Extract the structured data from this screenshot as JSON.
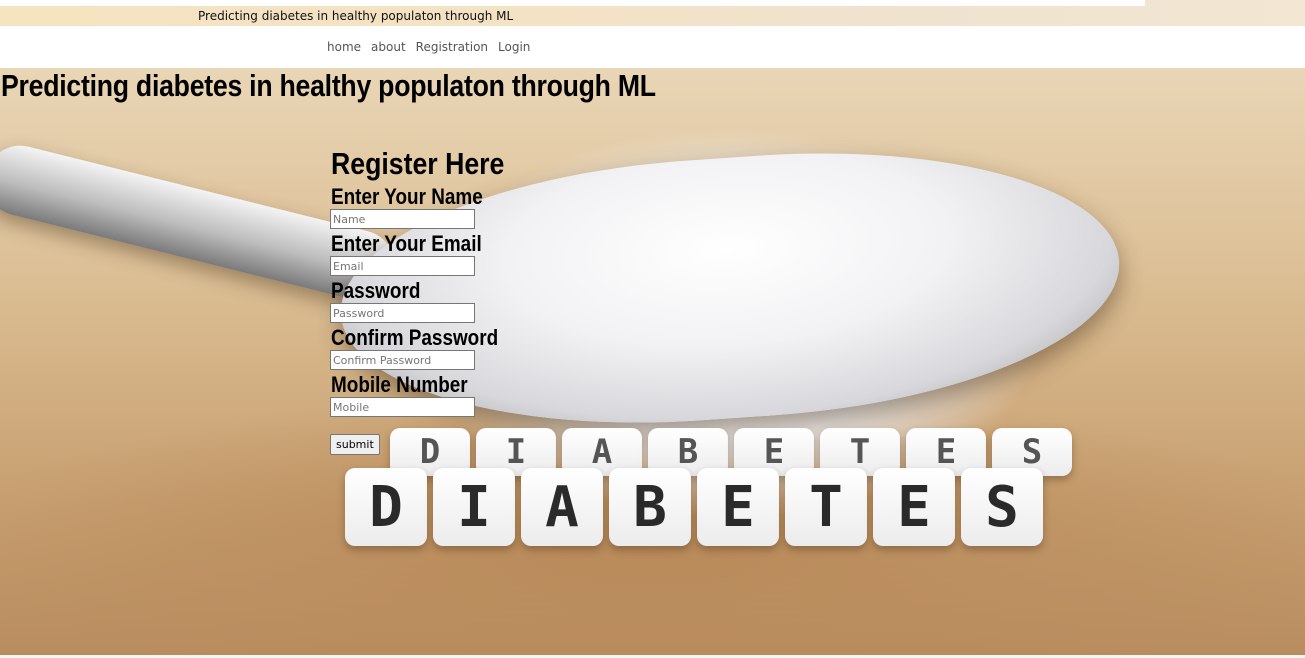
{
  "top_bar": {
    "title": "Predicting diabetes in healthy populaton through ML"
  },
  "nav": {
    "items": [
      {
        "label": "home"
      },
      {
        "label": "about"
      },
      {
        "label": "Registration"
      },
      {
        "label": "Login"
      }
    ]
  },
  "hero": {
    "heading": "Predicting diabetes in healthy populaton through ML",
    "dice_back": [
      "D",
      "I",
      "A",
      "B",
      "E",
      "T",
      "E",
      "S"
    ],
    "dice_front": [
      "D",
      "I",
      "A",
      "B",
      "E",
      "T",
      "E",
      "S"
    ]
  },
  "form": {
    "title": "Register Here",
    "name_label": "Enter Your Name",
    "name_placeholder": "Name",
    "email_label": "Enter Your Email",
    "email_placeholder": "Email",
    "password_label": "Password",
    "password_placeholder": "Password",
    "confirm_label": "Confirm Password",
    "confirm_placeholder": "Confirm Password",
    "mobile_label": "Mobile Number",
    "mobile_placeholder": "Mobile",
    "submit_label": "submit"
  }
}
